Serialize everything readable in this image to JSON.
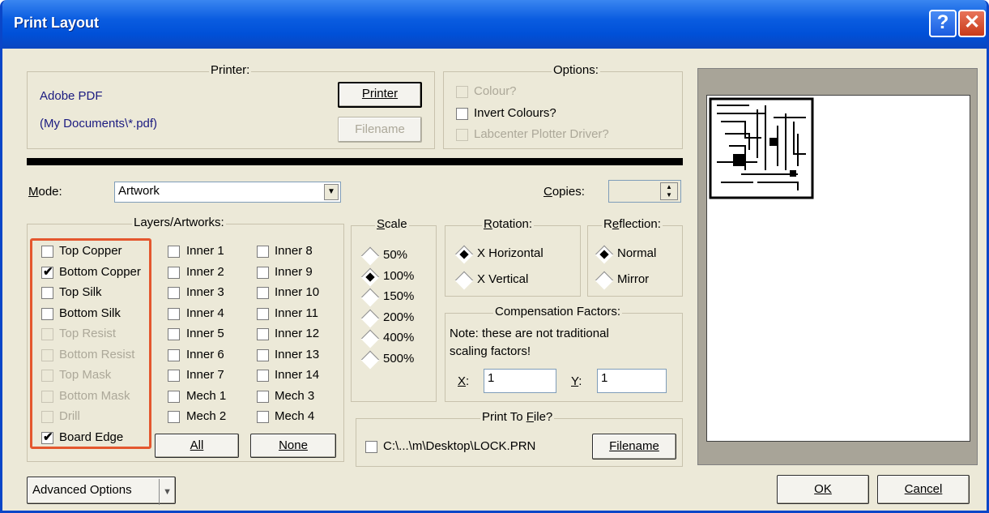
{
  "window": {
    "title": "Print Layout",
    "help_glyph": "?",
    "close_glyph": "✕"
  },
  "printer": {
    "group_label": "Printer:",
    "name": "Adobe PDF",
    "path": "(My Documents\\*.pdf)",
    "printer_button": "Printer",
    "filename_button": "Filename"
  },
  "options": {
    "group_label": "Options:",
    "colour": "Colour?",
    "invert": "Invert Colours?",
    "plotter": "Labcenter Plotter Driver?"
  },
  "mode": {
    "label": "Mode:",
    "value": "Artwork"
  },
  "copies": {
    "label": "Copies:",
    "value": ""
  },
  "layers": {
    "group_label": "Layers/Artworks:",
    "col1": [
      {
        "label": "Top Copper",
        "checked": false,
        "disabled": false
      },
      {
        "label": "Bottom Copper",
        "checked": true,
        "disabled": false
      },
      {
        "label": "Top Silk",
        "checked": false,
        "disabled": false
      },
      {
        "label": "Bottom Silk",
        "checked": false,
        "disabled": false
      },
      {
        "label": "Top Resist",
        "checked": false,
        "disabled": true
      },
      {
        "label": "Bottom Resist",
        "checked": false,
        "disabled": true
      },
      {
        "label": "Top Mask",
        "checked": false,
        "disabled": true
      },
      {
        "label": "Bottom Mask",
        "checked": false,
        "disabled": true
      },
      {
        "label": "Drill",
        "checked": false,
        "disabled": true
      },
      {
        "label": "Board Edge",
        "checked": true,
        "disabled": false
      }
    ],
    "col2": [
      "Inner 1",
      "Inner 2",
      "Inner 3",
      "Inner 4",
      "Inner 5",
      "Inner 6",
      "Inner 7",
      "Mech 1",
      "Mech 2"
    ],
    "col3": [
      "Inner 8",
      "Inner 9",
      "Inner 10",
      "Inner 11",
      "Inner 12",
      "Inner 13",
      "Inner 14",
      "Mech 3",
      "Mech 4"
    ],
    "all_button": "All",
    "none_button": "None",
    "highlight_color": "#e4572e"
  },
  "scale": {
    "group_label": "Scale",
    "options": [
      "50%",
      "100%",
      "150%",
      "200%",
      "400%",
      "500%"
    ],
    "selected": "100%"
  },
  "rotation": {
    "group_label": "Rotation:",
    "options": [
      "X Horizontal",
      "X Vertical"
    ],
    "selected": "X Horizontal"
  },
  "reflection": {
    "group_label": "Reflection:",
    "options": [
      "Normal",
      "Mirror"
    ],
    "selected": "Normal"
  },
  "compensation": {
    "group_label": "Compensation Factors:",
    "note_line1": "Note: these are not traditional",
    "note_line2": "scaling factors!",
    "x_label": "X:",
    "x_value": "1",
    "y_label": "Y:",
    "y_value": "1"
  },
  "print_to_file": {
    "group_label": "Print To File?",
    "path": "C:\\...\\m\\Desktop\\LOCK.PRN",
    "filename_button": "Filename"
  },
  "footer": {
    "advanced": "Advanced Options",
    "ok": "OK",
    "cancel": "Cancel"
  }
}
